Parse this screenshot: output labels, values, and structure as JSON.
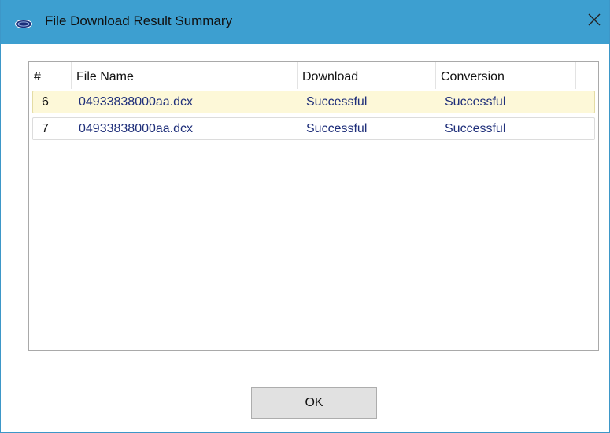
{
  "window": {
    "title": "File Download Result Summary",
    "icon": "app-logo-icon",
    "close_icon": "close-icon"
  },
  "table": {
    "columns": [
      "#",
      "File Name",
      "Download",
      "Conversion"
    ],
    "rows": [
      {
        "num": "6",
        "file_name": "04933838000aa.dcx",
        "download": "Successful",
        "conversion": "Successful",
        "selected": true
      },
      {
        "num": "7",
        "file_name": "04933838000aa.dcx",
        "download": "Successful",
        "conversion": "Successful",
        "selected": false
      }
    ]
  },
  "buttons": {
    "ok_label": "OK"
  },
  "colors": {
    "titlebar": "#3d9fd0",
    "row_text": "#1f2f7a",
    "selected_row_bg": "#fdf8d8"
  }
}
